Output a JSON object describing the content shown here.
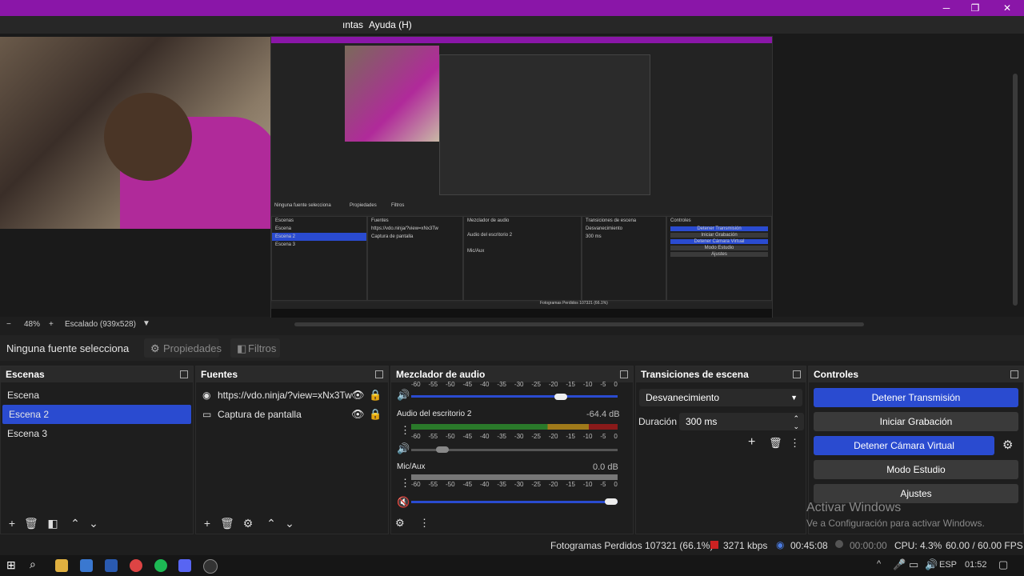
{
  "menu": {
    "partial_left": "ıntas",
    "help": "Ayuda (H)"
  },
  "window_buttons": {
    "min": "─",
    "max": "❐",
    "close": "✕"
  },
  "preview": {
    "zoom_minus": "−",
    "zoom": "48%",
    "zoom_plus": "+",
    "scale_label": "Escalado (939x528)"
  },
  "source_bar": {
    "no_source": "Ninguna fuente selecciona",
    "properties": "Propiedades",
    "filters": "Filtros"
  },
  "scenes": {
    "title": "Escenas",
    "items": [
      "Escena",
      "Escena 2",
      "Escena 3"
    ],
    "selected_index": 1
  },
  "sources": {
    "title": "Fuentes",
    "items": [
      "https://vdo.ninja/?view=xNx3Tw",
      "Captura de pantalla"
    ]
  },
  "mixer": {
    "title": "Mezclador de audio",
    "ticks": [
      "-60",
      "-55",
      "-50",
      "-45",
      "-40",
      "-35",
      "-30",
      "-25",
      "-20",
      "-15",
      "-10",
      "-5",
      "0"
    ],
    "channels": [
      {
        "name": "Audio del escritorio 2",
        "db": "-64.4 dB"
      },
      {
        "name": "Mic/Aux",
        "db": "0.0 dB"
      }
    ]
  },
  "transitions": {
    "title": "Transiciones de escena",
    "selected": "Desvanecimiento",
    "duration_label": "Duración",
    "duration_value": "300 ms"
  },
  "controls": {
    "title": "Controles",
    "stop_stream": "Detener Transmisión",
    "start_record": "Iniciar Grabación",
    "stop_virtual_cam": "Detener Cámara Virtual",
    "studio_mode": "Modo Estudio",
    "settings": "Ajustes"
  },
  "watermark": {
    "title": "Activar Windows",
    "subtitle": "Ve a Configuración para activar Windows."
  },
  "status": {
    "dropped_frames": "Fotogramas Perdidos 107321 (66.1%)",
    "bitrate": "3271 kbps",
    "stream_time": "00:45:08",
    "record_time": "00:00:00",
    "cpu": "CPU: 4.3%",
    "fps": "60.00 / 60.00 FPS"
  },
  "nested": {
    "no_source": "Ninguna fuente selecciona",
    "properties": "Propiedades",
    "filters": "Filtros",
    "scenes_title": "Escenas",
    "sources_title": "Fuentes",
    "mixer_title": "Mezclador de audio",
    "transitions_title": "Transiciones de escena",
    "controls_title": "Controles",
    "source_url": "https://vdo.ninja/?view=xNx3Tw",
    "transition": "Desvanecimiento",
    "duration_label": "Duración",
    "duration_value": "300 ms",
    "channel_name": "Audio del escritorio 2",
    "channel_db": "-64.4 dB",
    "mic_name": "Mic/Aux",
    "mic_db": "0.0 dB",
    "watermark": "Activar Windows",
    "watermark_sub": "Ve a Configuración para activar Windows.",
    "status": "Fotogramas Perdidos 107321 (66.1%)",
    "bitrate": "3271 kbps",
    "stream_time": "00:45:08",
    "record_time": "00:00:00",
    "cpu": "CPU: 4.3%",
    "fps": "60.00 / 60.00 FPS",
    "time": "01:52"
  },
  "taskbar": {
    "lang": "ESP",
    "time": "01:52"
  }
}
